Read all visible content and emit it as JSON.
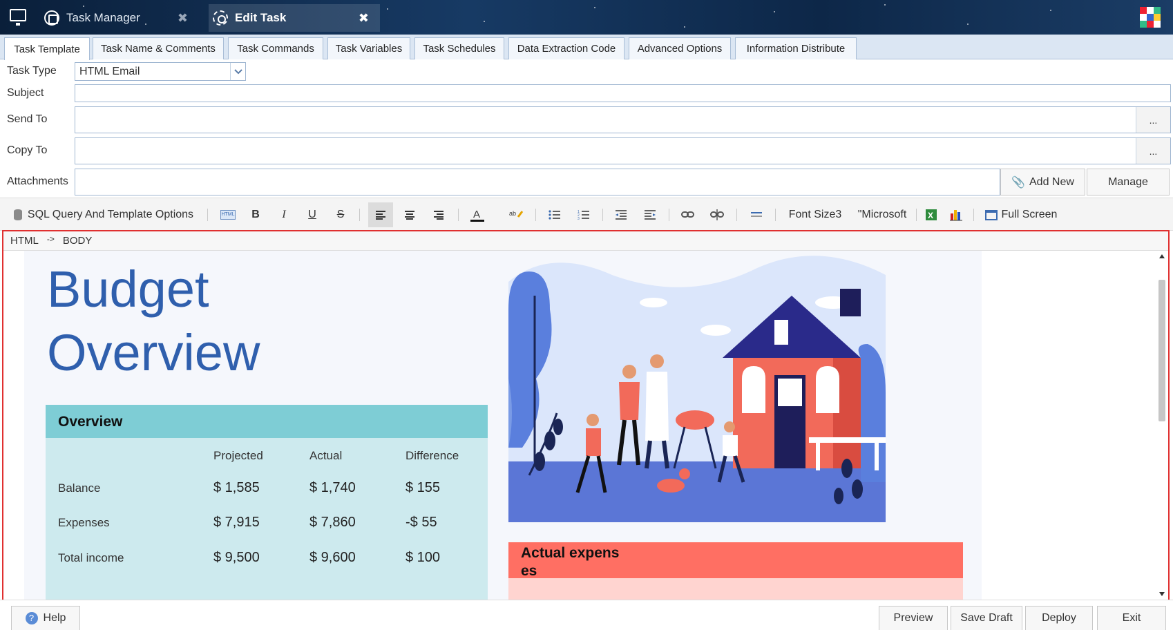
{
  "titlebar": {
    "tabs": [
      {
        "label": "Task Manager"
      },
      {
        "label": "Edit Task"
      }
    ],
    "close_glyph": "✖"
  },
  "page_tabs": [
    "Task Template",
    "Task Name & Comments",
    "Task Commands",
    "Task Variables",
    "Task Schedules",
    "Data Extraction Code",
    "Advanced Options",
    "Information Distribute"
  ],
  "form": {
    "task_type_label": "Task Type",
    "task_type_value": "HTML Email",
    "subject_label": "Subject",
    "send_to_label": "Send To",
    "copy_to_label": "Copy To",
    "attachments_label": "Attachments",
    "browse_label": "...",
    "add_new_label": "Add New",
    "manage_label": "Manage"
  },
  "toolbar": {
    "sql_label": "SQL Query And Template Options",
    "bold": "B",
    "italic": "I",
    "underline": "U",
    "strike": "S",
    "font_size": "Font Size3",
    "font_name": "\"Microsoft",
    "full_screen": "Full Screen"
  },
  "breadcrumb": {
    "html": "HTML",
    "arrow": "->",
    "body": "BODY"
  },
  "document": {
    "title_line1": "Budget",
    "title_line2": "Overview",
    "overview": {
      "heading": "Overview",
      "columns": [
        "Projected",
        "Actual",
        "Difference"
      ],
      "rows": [
        {
          "label": "Balance",
          "projected": "$ 1,585",
          "actual": "$ 1,740",
          "difference": "$ 155"
        },
        {
          "label": "Expenses",
          "projected": "$ 7,915",
          "actual": "$ 7,860",
          "difference": "-$ 55"
        },
        {
          "label": "Total income",
          "projected": "$ 9,500",
          "actual": "$ 9,600",
          "difference": "$ 100"
        }
      ]
    },
    "actual_expenses_line1": "Actual expens",
    "actual_expenses_line2": "es"
  },
  "footer": {
    "help": "Help",
    "preview": "Preview",
    "save_draft": "Save Draft",
    "deploy": "Deploy",
    "exit": "Exit"
  },
  "colors": {
    "accent": "#2f5fad",
    "overview_header": "#7ecdd5",
    "overview_body": "#cdeaee",
    "expenses_header": "#ff6f63",
    "editor_border": "#e03030"
  }
}
